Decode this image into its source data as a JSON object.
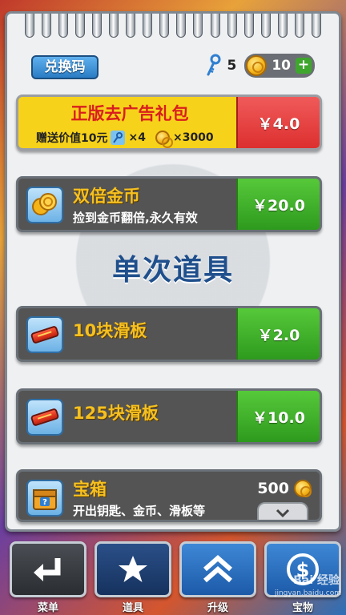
{
  "header": {
    "redeem_label": "兑换码",
    "keys_count": "5",
    "coins_count": "10",
    "add_label": "+"
  },
  "promo": {
    "title": "正版去广告礼包",
    "gift_label": "赠送价值10元",
    "keys_amount": "×4",
    "coins_amount": "×3000",
    "price": "￥4.0"
  },
  "double_coins": {
    "title": "双倍金币",
    "desc": "捡到金币翻倍,永久有效",
    "price": "￥20.0"
  },
  "section_title": "单次道具",
  "items": [
    {
      "title": "10块滑板",
      "price": "￥2.0"
    },
    {
      "title": "125块滑板",
      "price": "￥10.0"
    }
  ],
  "chest": {
    "title": "宝箱",
    "desc": "开出钥匙、金币、滑板等",
    "price": "500"
  },
  "nav": [
    {
      "label": "菜单",
      "icon": "return-arrow-icon"
    },
    {
      "label": "道具",
      "icon": "star-icon"
    },
    {
      "label": "升级",
      "icon": "double-chevron-up-icon"
    },
    {
      "label": "宝物",
      "icon": "dollar-icon"
    }
  ],
  "watermark": {
    "text": "Bai 经验",
    "url": "jingyan.baidu.com"
  },
  "colors": {
    "buy_green": "#3ea62d",
    "promo_red": "#dd2f2f",
    "promo_yellow": "#f7d21a",
    "title_gold": "#f5c020"
  }
}
